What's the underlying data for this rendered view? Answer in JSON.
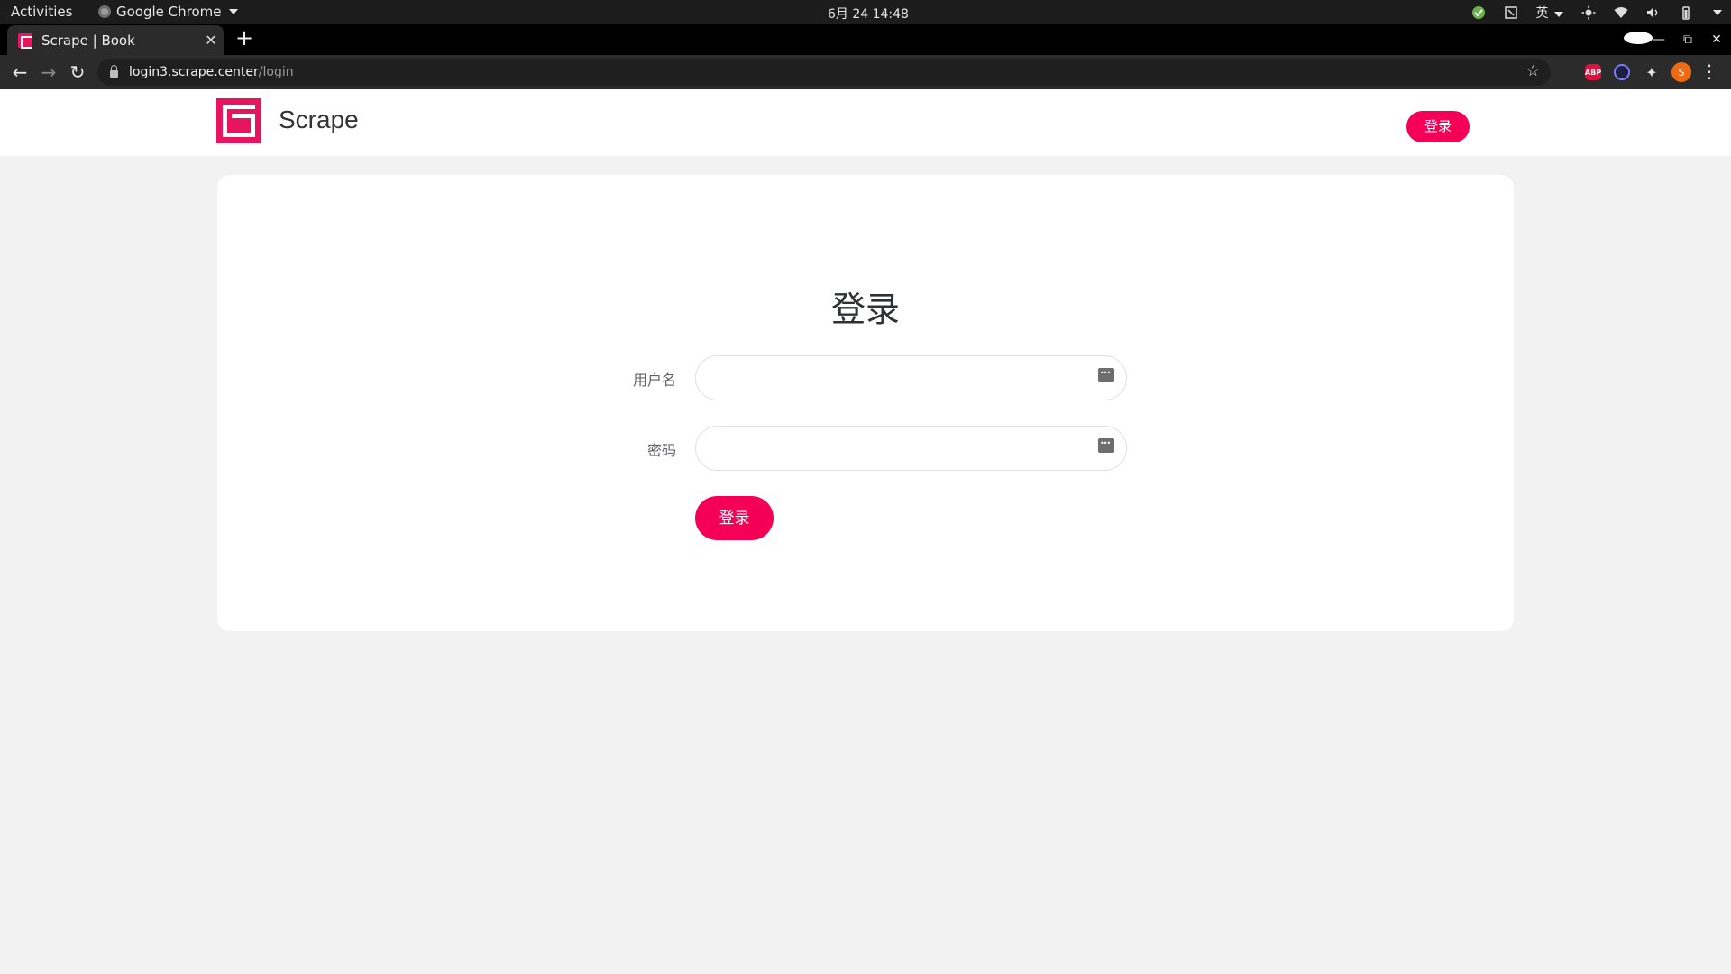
{
  "system_bar": {
    "activities": "Activities",
    "app_name": "Google Chrome",
    "clock": "6月 24  14:48",
    "input_method": "英"
  },
  "browser": {
    "tab": {
      "title": "Scrape | Book",
      "close": "✕"
    },
    "new_tab": "+",
    "url_host": "login3.scrape.center",
    "url_path": "/login",
    "extensions": {
      "abp": "ABP",
      "avatar": "S"
    }
  },
  "site": {
    "brand": "Scrape",
    "header_login": "登录"
  },
  "login_form": {
    "title": "登录",
    "username_label": "用户名",
    "username_value": "",
    "password_label": "密码",
    "password_value": "",
    "submit_label": "登录"
  },
  "colors": {
    "accent": "#f50057",
    "logo": "#e8145e",
    "page_background": "#f2f2f2"
  }
}
